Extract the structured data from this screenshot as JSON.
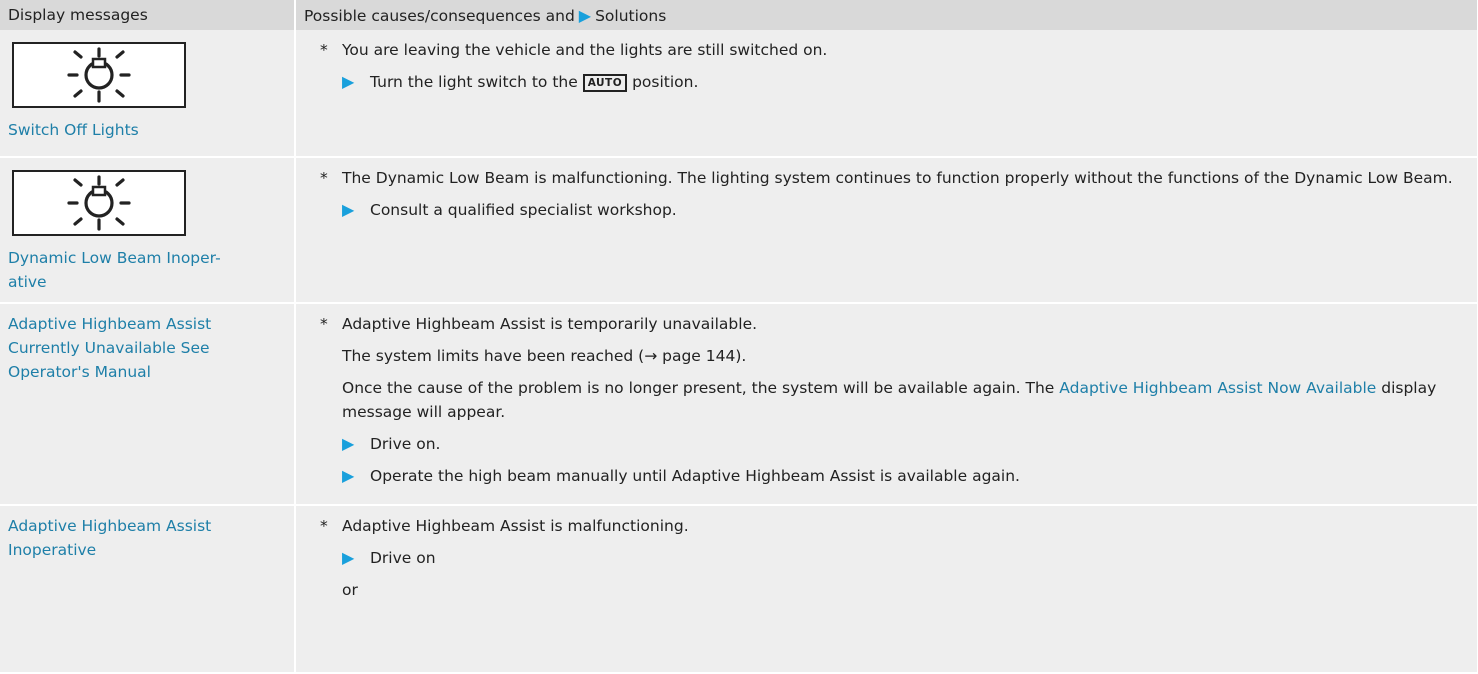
{
  "header": {
    "col1": "Display messages",
    "col2_prefix": "Possible causes/consequences and",
    "col2_suffix": "Solutions"
  },
  "rows": [
    {
      "icon": "light-bulb-icon",
      "message": "Switch Off Lights",
      "cause": "You are leaving the vehicle and the lights are still switched on.",
      "solution_before": "Turn the light switch to the",
      "solution_key": "AUTO",
      "solution_after": "position."
    },
    {
      "icon": "light-bulb-icon",
      "message_line1": "Dynamic Low Beam Inoper-",
      "message_line2": "ative",
      "cause": "The Dynamic Low Beam is malfunctioning. The lighting system continues to function properly without the functions of the Dynamic Low Beam.",
      "solution": "Consult a qualified specialist workshop."
    },
    {
      "message_line1": "Adaptive Highbeam Assist",
      "message_line2": "Currently Unavailable See",
      "message_line3": "Operator's Manual",
      "cause": "Adaptive Highbeam Assist is temporarily unavailable.",
      "para1": "The system limits have been reached (→ page 144).",
      "para2_before": "Once the cause of the problem is no longer present, the system will be available again. The",
      "para2_link": "Adaptive Highbeam Assist Now Available",
      "para2_after": "display message will appear.",
      "solution1": "Drive on.",
      "solution2": "Operate the high beam manually until Adaptive Highbeam Assist is available again."
    },
    {
      "message_line1": "Adaptive Highbeam Assist",
      "message_line2": "Inoperative",
      "cause": "Adaptive Highbeam Assist is malfunctioning.",
      "solution1": "Drive on",
      "or": "or"
    }
  ],
  "symbols": {
    "star": "*",
    "arrow": "▶"
  },
  "colors": {
    "link": "#1e7fa8",
    "arrow": "#19a0dc",
    "header_bg": "#d9d9d9",
    "row_bg": "#eeeeee"
  }
}
